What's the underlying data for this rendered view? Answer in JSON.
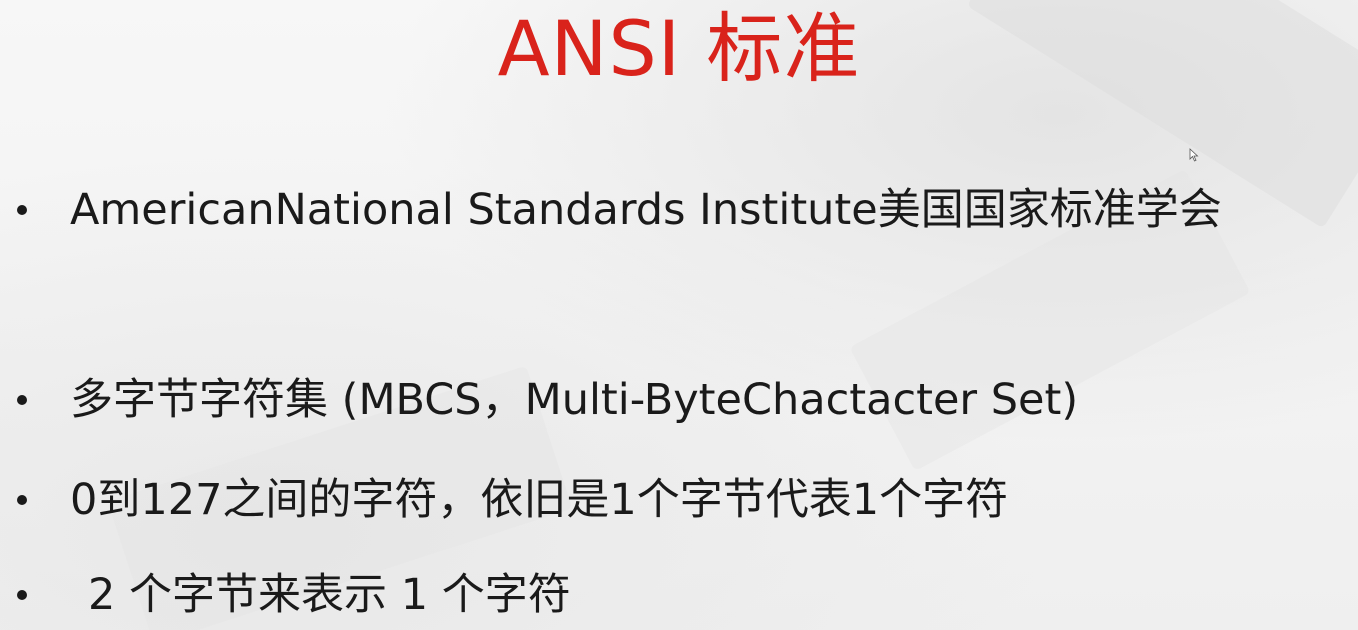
{
  "slide": {
    "title": "ANSI 标准",
    "bullets": [
      {
        "text": "AmericanNational Standards Institute美国国家标准学会"
      },
      {
        "text": "多字节字符集 (MBCS，Multi-ByteChactacter Set)"
      },
      {
        "text": "0到127之间的字符，依旧是1个字节代表1个字符"
      },
      {
        "text": "2 个字节来表示 1 个字符"
      }
    ]
  },
  "colors": {
    "title": "#d9231b",
    "text": "#1a1a1a",
    "background": "#f3f3f3"
  },
  "icons": {
    "cursor": "mouse-pointer-icon"
  }
}
